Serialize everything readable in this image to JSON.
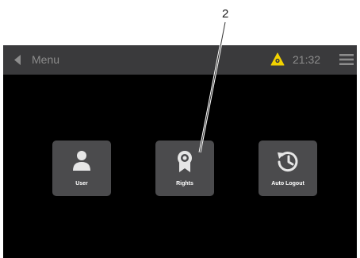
{
  "callout": {
    "number": "2"
  },
  "topbar": {
    "back_icon": "chevron-left-icon",
    "title": "Menu",
    "warning_icon": "warning-triangle-icon",
    "warning_color": "#f2d200",
    "time": "21:32",
    "menu_icon": "hamburger-icon"
  },
  "tiles": [
    {
      "label": "User",
      "icon": "user-icon"
    },
    {
      "label": "Rights",
      "icon": "rights-badge-icon"
    },
    {
      "label": "Auto Logout",
      "icon": "history-icon"
    }
  ],
  "colors": {
    "screen_background": "#000000",
    "topbar_background": "#3a3a3c",
    "tile_background": "#4b4b4d",
    "icon_color": "#e6e6e6",
    "muted_text": "#8c8c8c"
  }
}
